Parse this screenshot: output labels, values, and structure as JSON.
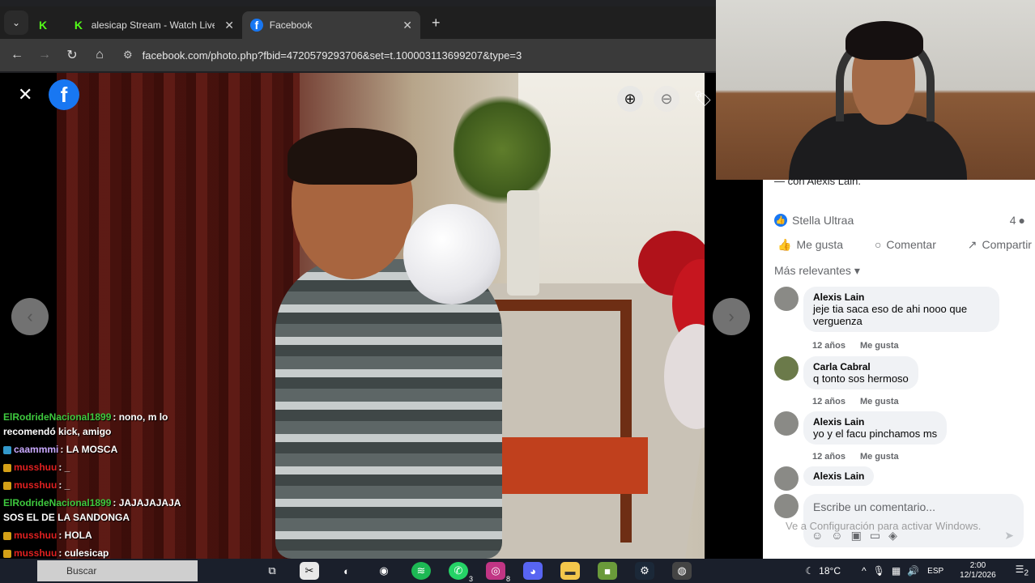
{
  "browser": {
    "tabs": [
      {
        "label": "",
        "icon": "kick-icon"
      },
      {
        "label": "alesicap Stream - Watch Live on",
        "icon": "kick-icon"
      },
      {
        "label": "Facebook",
        "icon": "facebook-icon"
      }
    ],
    "url": "facebook.com/photo.php?fbid=4720579293706&set=t.100003113699207&type=3"
  },
  "chat": [
    {
      "user": "ElRodrideNacional1899",
      "user_color": "#3ec93e",
      "text": ": nono, m lo recomendó kick, amigo"
    },
    {
      "user": "caammmi",
      "user_color": "#c9a9ff",
      "text": ": LA MOSCA"
    },
    {
      "user": "musshuu",
      "user_color": "#e02020",
      "text": ": _"
    },
    {
      "user": "musshuu",
      "user_color": "#e02020",
      "text": ": _"
    },
    {
      "user": "ElRodrideNacional1899",
      "user_color": "#3ec93e",
      "text": ": JAJAJAJAJA SOS EL DE LA SANDONGA"
    },
    {
      "user": "musshuu",
      "user_color": "#e02020",
      "text": ": HOLA"
    },
    {
      "user": "musshuu",
      "user_color": "#e02020",
      "text": ": culesicap"
    }
  ],
  "post": {
    "caption": "— con Alexis Lain.",
    "reactor": "Stella Ultraa",
    "comment_count": "4",
    "actions": {
      "like": "Me gusta",
      "comment": "Comentar",
      "share": "Compartir"
    },
    "sort_label": "Más relevantes"
  },
  "comments": [
    {
      "name": "Alexis Lain",
      "text": "jeje tia saca eso de ahi nooo que verguenza",
      "age": "12 años",
      "like": "Me gusta"
    },
    {
      "name": "Carla Cabral",
      "text": "q tonto sos hermoso",
      "age": "12 años",
      "like": "Me gusta"
    },
    {
      "name": "Alexis Lain",
      "text": "yo y el facu pinchamos ms",
      "age": "12 años",
      "like": "Me gusta"
    },
    {
      "name": "Alexis Lain",
      "text": "",
      "age": "",
      "like": ""
    }
  ],
  "composer": {
    "placeholder": "Escribe un comentario..."
  },
  "watermark": {
    "line": "Ve a Configuración para activar Windows."
  },
  "taskbar": {
    "search": "Buscar",
    "weather": "18°C",
    "lang": "ESP",
    "time": "2:00",
    "date": "12/1/2026",
    "notification_count": "2",
    "badges": {
      "whatsapp": "3",
      "instagram": "8"
    }
  },
  "colors": {
    "facebook_blue": "#1877f2",
    "kick_green": "#53fc18"
  }
}
